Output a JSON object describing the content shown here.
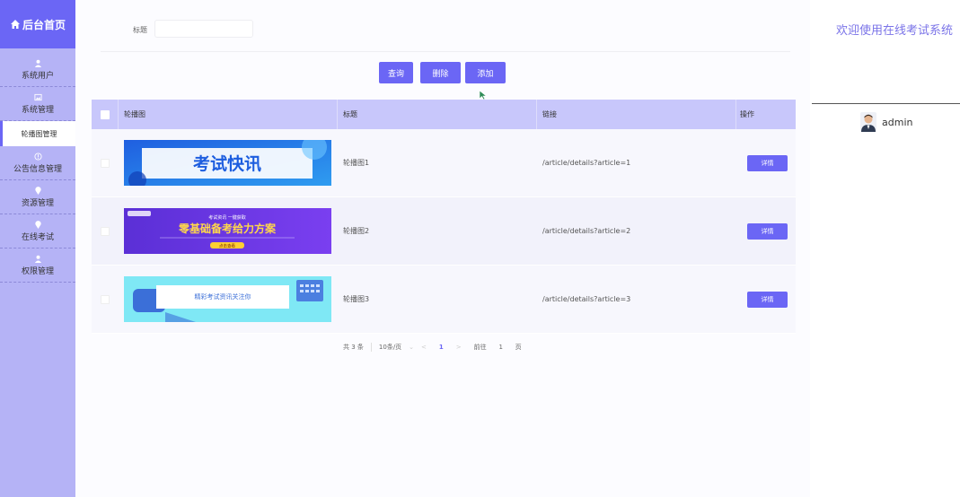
{
  "sidebar": {
    "title": "后台首页",
    "items": [
      {
        "label": "系统用户",
        "icon": "user-icon"
      },
      {
        "label": "系统管理",
        "icon": "image-icon"
      },
      {
        "label": "轮播图管理",
        "icon": "",
        "active": true
      },
      {
        "label": "公告信息管理",
        "icon": "info-icon"
      },
      {
        "label": "资源管理",
        "icon": "location-icon"
      },
      {
        "label": "在线考试",
        "icon": "location-icon"
      },
      {
        "label": "权限管理",
        "icon": "user-icon"
      }
    ]
  },
  "search": {
    "label": "标题",
    "value": "",
    "placeholder": ""
  },
  "toolbar": {
    "query_label": "查询",
    "delete_label": "删除",
    "add_label": "添加"
  },
  "table": {
    "headers": [
      "轮播图",
      "标题",
      "链接",
      "操作"
    ],
    "rows": [
      {
        "banner_text": "考试快讯",
        "title": "轮播图1",
        "link": "/article/details?article=1",
        "action": "详情"
      },
      {
        "banner_text": "零基础备考给力方案",
        "banner_sub": "考试资讯 一键获取",
        "banner_btn": "点击查看",
        "title": "轮播图2",
        "link": "/article/details?article=2",
        "action": "详情"
      },
      {
        "banner_text": "精彩考试资讯关注你",
        "title": "轮播图3",
        "link": "/article/details?article=3",
        "action": "详情"
      }
    ]
  },
  "pagination": {
    "total": "共 3 条",
    "page_size": "10条/页",
    "prev": "<",
    "current": "1",
    "next": ">",
    "goto_label": "前往",
    "goto_value": "1",
    "page_unit": "页"
  },
  "header": {
    "welcome": "欢迎使用在线考试系统"
  },
  "user": {
    "name": "admin"
  },
  "colors": {
    "accent": "#6b66f5",
    "sidebar": "#b5b3f6",
    "table_header": "#c8c7fb"
  }
}
